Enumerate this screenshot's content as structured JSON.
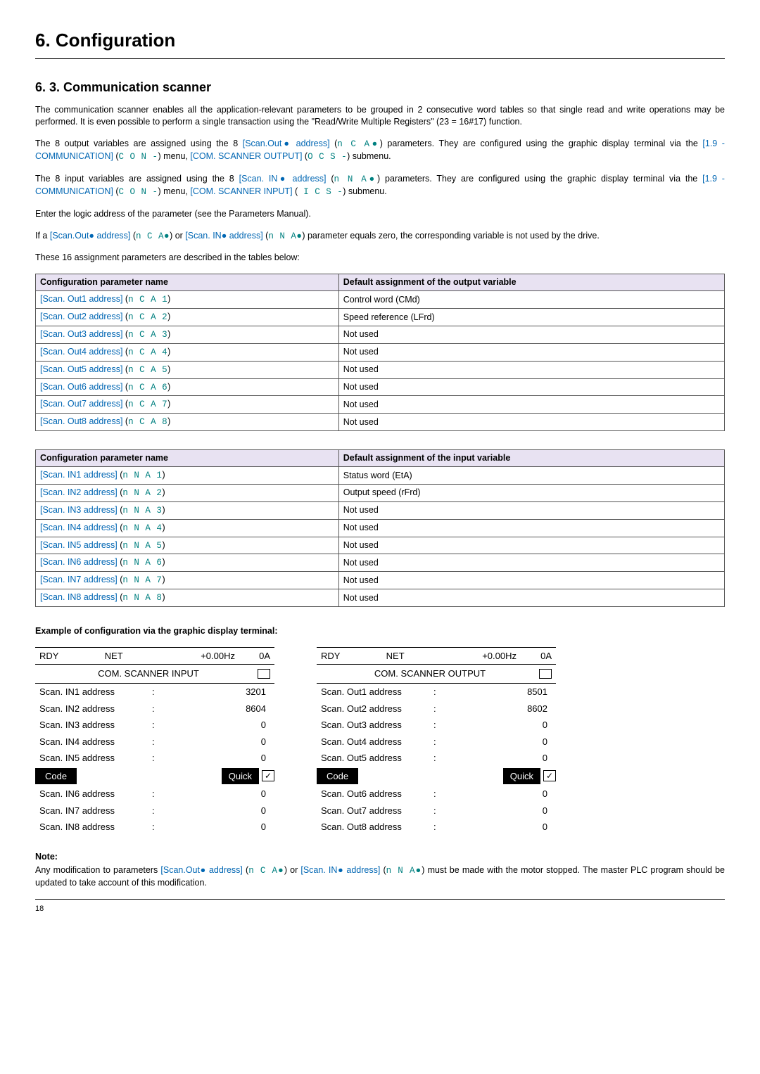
{
  "page": {
    "title": "6. Configuration",
    "section": "6. 3. Communication scanner",
    "number": "18"
  },
  "intro": {
    "p1a": "The communication scanner enables all the application-relevant parameters to be grouped in 2 consecutive word tables so that single read and write operations may be performed. It is even possible to perform a single transaction using the \"Read/Write Multiple Registers\" (23 = 16#17) function.",
    "p2_pre": "The 8 output variables are assigned using the 8 ",
    "p2_link1": "[Scan.Out● address]",
    "p2_code1": "n C A●",
    "p2_mid1": ") parameters. They are configured using the graphic display terminal via the ",
    "p2_link2": "[1.9 - COMMUNICATION]",
    "p2_code2": "C O N -",
    "p2_mid2": ") menu, ",
    "p2_link3": "[COM. SCANNER OUTPUT]",
    "p2_code3": "O C S -",
    "p2_end": ") submenu.",
    "p3_pre": "The 8 input variables are assigned using the 8 ",
    "p3_link1": "[Scan. IN● address]",
    "p3_code1": "n N A●",
    "p3_mid1": ") parameters. They are configured using the graphic display terminal via the ",
    "p3_link2": "[1.9 - COMMUNICATION]",
    "p3_code2": "C O N -",
    "p3_mid2": ") menu, ",
    "p3_link3": "[COM. SCANNER INPUT]",
    "p3_code3": " I C S -",
    "p3_end": ") submenu.",
    "p4": "Enter the logic address of the parameter (see the Parameters Manual).",
    "p5_pre": "If a ",
    "p5_link1": "[Scan.Out● address]",
    "p5_code1": "n C A●",
    "p5_mid": ") or ",
    "p5_link2": "[Scan. IN● address]",
    "p5_code2": "n N A●",
    "p5_end": ") parameter equals zero, the corresponding variable is not used by the drive.",
    "p6": "These 16 assignment parameters are described in the tables below:"
  },
  "table_out": {
    "h1": "Configuration parameter name",
    "h2": "Default assignment of the output variable",
    "rows": [
      {
        "link": "[Scan. Out1 address]",
        "code": "n C A 1",
        "val": "Control word (CMd)"
      },
      {
        "link": "[Scan. Out2 address]",
        "code": "n C A 2",
        "val": "Speed reference (LFrd)"
      },
      {
        "link": "[Scan. Out3 address]",
        "code": "n C A 3",
        "val": "Not used"
      },
      {
        "link": "[Scan. Out4 address]",
        "code": "n C A 4",
        "val": "Not used"
      },
      {
        "link": "[Scan. Out5 address]",
        "code": "n C A 5",
        "val": "Not used"
      },
      {
        "link": "[Scan. Out6 address]",
        "code": "n C A 6",
        "val": "Not used"
      },
      {
        "link": "[Scan. Out7 address]",
        "code": "n C A 7",
        "val": "Not used"
      },
      {
        "link": "[Scan. Out8 address]",
        "code": "n C A 8",
        "val": "Not used"
      }
    ]
  },
  "table_in": {
    "h1": "Configuration parameter name",
    "h2": "Default assignment of the input variable",
    "rows": [
      {
        "link": "[Scan. IN1 address]",
        "code": "n N A 1",
        "val": "Status word (EtA)"
      },
      {
        "link": "[Scan. IN2 address]",
        "code": "n N A 2",
        "val": "Output speed (rFrd)"
      },
      {
        "link": "[Scan. IN3 address]",
        "code": "n N A 3",
        "val": "Not used"
      },
      {
        "link": "[Scan. IN4 address]",
        "code": "n N A 4",
        "val": "Not used"
      },
      {
        "link": "[Scan. IN5 address]",
        "code": "n N A 5",
        "val": "Not used"
      },
      {
        "link": "[Scan. IN6 address]",
        "code": "n N A 6",
        "val": "Not used"
      },
      {
        "link": "[Scan. IN7 address]",
        "code": "n N A 7",
        "val": "Not used"
      },
      {
        "link": "[Scan. IN8 address]",
        "code": "n N A 8",
        "val": "Not used"
      }
    ]
  },
  "example_title": "Example of configuration via the graphic display terminal:",
  "terminal_in": {
    "status": {
      "a": "RDY",
      "b": "NET",
      "c": "+0.00Hz",
      "d": "0A"
    },
    "title": "COM. SCANNER INPUT",
    "rows_top": [
      {
        "label": "Scan. IN1 address",
        "val": "3201"
      },
      {
        "label": "Scan. IN2 address",
        "val": "8604"
      },
      {
        "label": "Scan. IN3 address",
        "val": "0"
      },
      {
        "label": "Scan. IN4 address",
        "val": "0"
      },
      {
        "label": "Scan. IN5 address",
        "val": "0"
      }
    ],
    "footer": {
      "code": "Code",
      "quick": "Quick",
      "check": "✓"
    },
    "rows_bottom": [
      {
        "label": "Scan. IN6 address",
        "val": "0"
      },
      {
        "label": "Scan. IN7 address",
        "val": "0"
      },
      {
        "label": "Scan. IN8 address",
        "val": "0"
      }
    ]
  },
  "terminal_out": {
    "status": {
      "a": "RDY",
      "b": "NET",
      "c": "+0.00Hz",
      "d": "0A"
    },
    "title": "COM. SCANNER OUTPUT",
    "rows_top": [
      {
        "label": "Scan. Out1 address",
        "val": "8501"
      },
      {
        "label": "Scan. Out2 address",
        "val": "8602"
      },
      {
        "label": "Scan. Out3 address",
        "val": "0"
      },
      {
        "label": "Scan. Out4 address",
        "val": "0"
      },
      {
        "label": "Scan. Out5 address",
        "val": "0"
      }
    ],
    "footer": {
      "code": "Code",
      "quick": "Quick",
      "check": "✓"
    },
    "rows_bottom": [
      {
        "label": "Scan. Out6 address",
        "val": "0"
      },
      {
        "label": "Scan. Out7 address",
        "val": "0"
      },
      {
        "label": "Scan. Out8 address",
        "val": "0"
      }
    ]
  },
  "note": {
    "title": "Note:",
    "pre": "Any modification to parameters ",
    "link1": "[Scan.Out● address]",
    "code1": "n C A●",
    "mid": ") or ",
    "link2": "[Scan. IN● address]",
    "code2": "n N A●",
    "end": ") must be made with the motor stopped. The master PLC program should be updated to take account of this modification."
  }
}
